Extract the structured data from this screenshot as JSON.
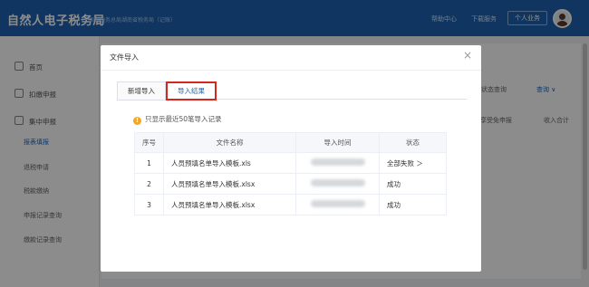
{
  "header": {
    "brand": "自然人电子税务局",
    "brand_sub": "国家税务总局湖南省税务局（记账）",
    "help_link": "帮助中心",
    "download_link": "下载服务",
    "personal_btn": "个人业务"
  },
  "sidebar": {
    "items": [
      {
        "label": "首页"
      },
      {
        "label": "扣缴申报"
      },
      {
        "label": "集中申报"
      }
    ],
    "sub_items": [
      {
        "label": "报表填报"
      },
      {
        "label": "退税申请"
      },
      {
        "label": "税款缴纳"
      },
      {
        "label": "申报记录查询"
      },
      {
        "label": "缴款记录查询"
      }
    ]
  },
  "background": {
    "query_label": "填报状态查询",
    "query_btn": "查询 ∨",
    "col_a": "享受免申报",
    "col_b": "收入合计"
  },
  "modal": {
    "title": "文件导入",
    "close": "×",
    "tabs": [
      {
        "label": "新增导入"
      },
      {
        "label": "导入结果"
      }
    ],
    "notice": "只显示最近50笔导入记录",
    "table": {
      "headers": [
        "序号",
        "文件名称",
        "导入时间",
        "状态"
      ],
      "rows": [
        {
          "num": "1",
          "name": "人员预填名单导入模板.xls",
          "status": "全部失败 ＞",
          "status_type": "fail"
        },
        {
          "num": "2",
          "name": "人员预填名单导入模板.xlsx",
          "status": "成功",
          "status_type": "ok"
        },
        {
          "num": "3",
          "name": "人员预填名单导入模板.xlsx",
          "status": "成功",
          "status_type": "ok"
        }
      ]
    }
  },
  "colors": {
    "header_bg": "#1c61b0",
    "accent": "#1a66c4",
    "fail": "#e64340",
    "success": "#2ea043",
    "highlight_box": "#d9261c"
  }
}
